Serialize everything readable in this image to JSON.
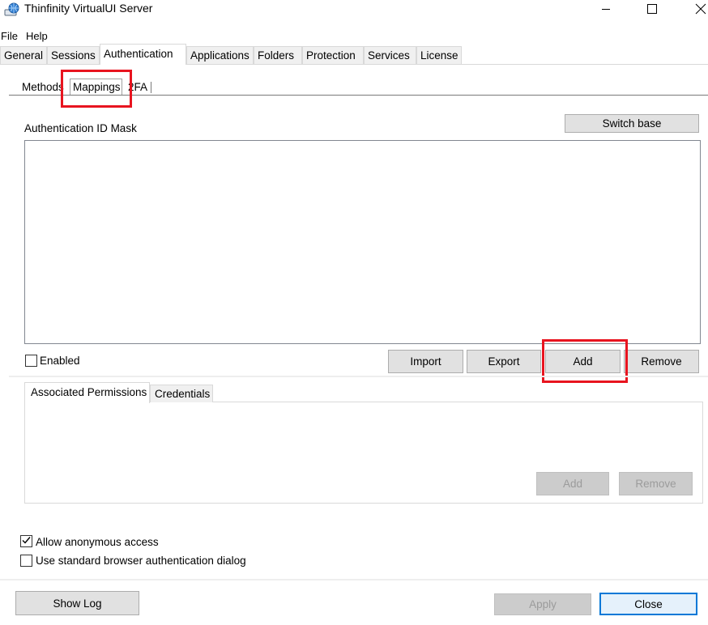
{
  "window": {
    "title": "Thinfinity VirtualUI Server"
  },
  "menu": [
    {
      "label": "File"
    },
    {
      "label": "Help"
    }
  ],
  "main_tabs": [
    {
      "label": "General"
    },
    {
      "label": "Sessions"
    },
    {
      "label": "Authentication",
      "active": true
    },
    {
      "label": "Applications"
    },
    {
      "label": "Folders"
    },
    {
      "label": "Protection"
    },
    {
      "label": "Services"
    },
    {
      "label": "License"
    }
  ],
  "sub_tabs": [
    {
      "label": "Methods"
    },
    {
      "label": "Mappings",
      "active": true
    },
    {
      "label": "2FA"
    }
  ],
  "mappings": {
    "list_label": "Authentication ID Mask",
    "switch_base_label": "Switch base",
    "enabled_label": "Enabled",
    "enabled_checked": false,
    "import_label": "Import",
    "export_label": "Export",
    "add_label": "Add",
    "remove_label": "Remove"
  },
  "inner_tabs": [
    {
      "label": "Associated Permissions",
      "active": true
    },
    {
      "label": "Credentials"
    }
  ],
  "permissions": {
    "add_label": "Add",
    "remove_label": "Remove"
  },
  "options": {
    "allow_anonymous_label": "Allow anonymous access",
    "allow_anonymous_checked": true,
    "standard_dialog_label": "Use standard browser authentication dialog",
    "standard_dialog_checked": false
  },
  "footer": {
    "show_log_label": "Show Log",
    "apply_label": "Apply",
    "close_label": "Close"
  },
  "colors": {
    "highlight": "#e8141f",
    "default_button_border": "#0078d7"
  },
  "icons": {
    "app": "server-globe-icon",
    "minimize": "minimize-icon",
    "maximize": "maximize-icon",
    "close": "close-icon",
    "check": "check-icon"
  }
}
